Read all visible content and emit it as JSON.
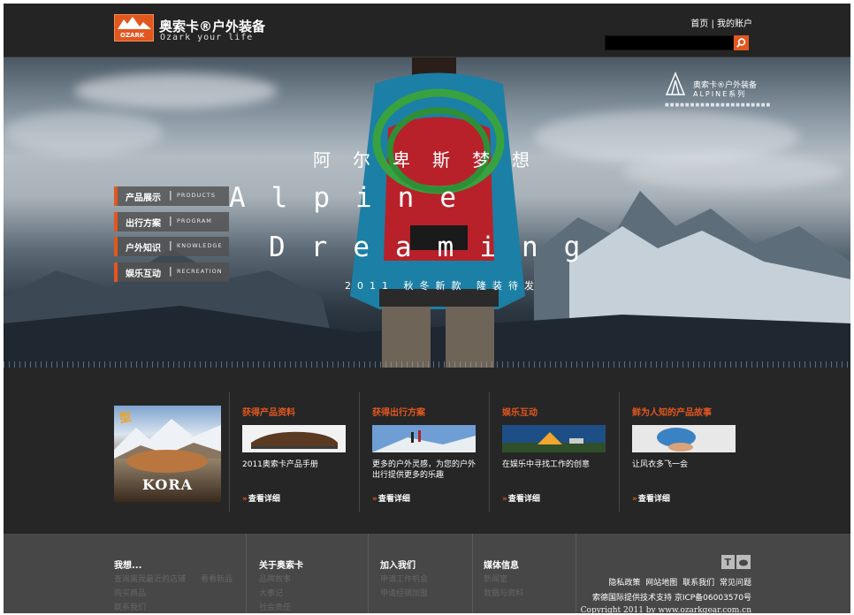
{
  "header": {
    "logo_mark": "OZARK",
    "brand_cn": "奥索卡®户外装备",
    "brand_en": "Ozark your life",
    "top_links": [
      "首页",
      "我的账户"
    ],
    "top_sep": " | ",
    "search": {
      "placeholder": ""
    }
  },
  "hero": {
    "series_title": "奥索卡®户外装备",
    "series_name": "ALPINE系列",
    "series_dots": "■■■■■■■■■■■■■■■■■■■■■",
    "cn_title": "阿尔卑斯梦想",
    "en_line1": "Alpine",
    "en_line2": "Dreaming",
    "tagline": "2011 秋冬新款 隆装待发"
  },
  "menu": [
    {
      "cn": "产品展示",
      "en": "PRODUCTS"
    },
    {
      "cn": "出行方案",
      "en": "PROGRAM"
    },
    {
      "cn": "户外知识",
      "en": "KNOWLEDGE"
    },
    {
      "cn": "娱乐互动",
      "en": "RECREATION"
    }
  ],
  "kora": {
    "badge": "型",
    "label": "KORA"
  },
  "promos": [
    {
      "title": "获得产品资料",
      "text": "2011奥索卡产品手册",
      "more": "查看详细"
    },
    {
      "title": "获得出行方案",
      "text": "更多的户外灵感，为您的户外出行提供更多的乐趣",
      "more": "查看详细"
    },
    {
      "title": "娱乐互动",
      "text": "在娱乐中寻找工作的创意",
      "more": "查看详细"
    },
    {
      "title": "鲜为人知的产品故事",
      "text": "让风衣多飞一会",
      "more": "查看详细"
    }
  ],
  "more_arrow": "»",
  "footer": {
    "cols": [
      {
        "head": "我想...",
        "links": [
          "查询离我最近的店铺",
          "看看新品",
          "购买商品",
          "联系我们"
        ]
      },
      {
        "head": "关于奥索卡",
        "links": [
          "品牌故事",
          "大事记",
          "社会责任"
        ]
      },
      {
        "head": "加入我们",
        "links": [
          "申请工作机会",
          "申请经销加盟"
        ]
      },
      {
        "head": "媒体信息",
        "links": [
          "新闻室",
          "数据与资料"
        ]
      }
    ],
    "bottom_links": "隐私政策 网站地图 联系我们 常见问题",
    "support": "索德国际提供技术支持 京ICP备06003570号",
    "copyright": "Copyright 2011 by www.ozarkgear.com.cn"
  },
  "colors": {
    "accent": "#e2571e",
    "background": "#262626",
    "footer": "#474747"
  }
}
